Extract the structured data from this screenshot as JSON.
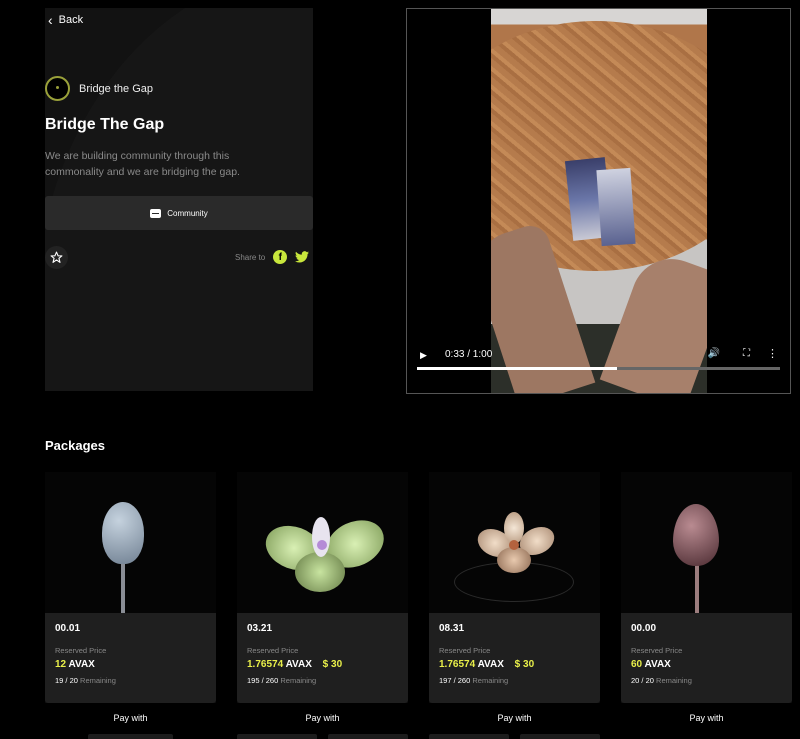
{
  "nav": {
    "back_label": "Back"
  },
  "project": {
    "brand_name": "Bridge the Gap",
    "title": "Bridge The Gap",
    "description": "We are building community through this commonality and we are bridging the gap.",
    "community_label": "Community",
    "share_label": "Share to"
  },
  "video": {
    "time_label": "0:33 / 1:00",
    "progress": 0.55
  },
  "packages": {
    "heading": "Packages",
    "items": [
      {
        "number": "00.01",
        "reserved_label": "Reserved Price",
        "price": "12",
        "currency": "AVAX",
        "usd": "",
        "remaining": "19 / 20",
        "remaining_label": "Remaining",
        "pay_with": "Pay with"
      },
      {
        "number": "03.21",
        "reserved_label": "Reserved Price",
        "price": "1.76574",
        "currency": "AVAX",
        "usd": "$ 30",
        "remaining": "195 / 260",
        "remaining_label": "Remaining",
        "pay_with": "Pay with"
      },
      {
        "number": "08.31",
        "reserved_label": "Reserved Price",
        "price": "1.76574",
        "currency": "AVAX",
        "usd": "$ 30",
        "remaining": "197 / 260",
        "remaining_label": "Remaining",
        "pay_with": "Pay with"
      },
      {
        "number": "00.00",
        "reserved_label": "Reserved Price",
        "price": "60",
        "currency": "AVAX",
        "usd": "",
        "remaining": "20 / 20",
        "remaining_label": "Remaining",
        "pay_with": "Pay with"
      }
    ]
  },
  "colors": {
    "accent": "#e9f04a",
    "card_bg": "#1f1f1f",
    "panel_bg": "#121212"
  }
}
